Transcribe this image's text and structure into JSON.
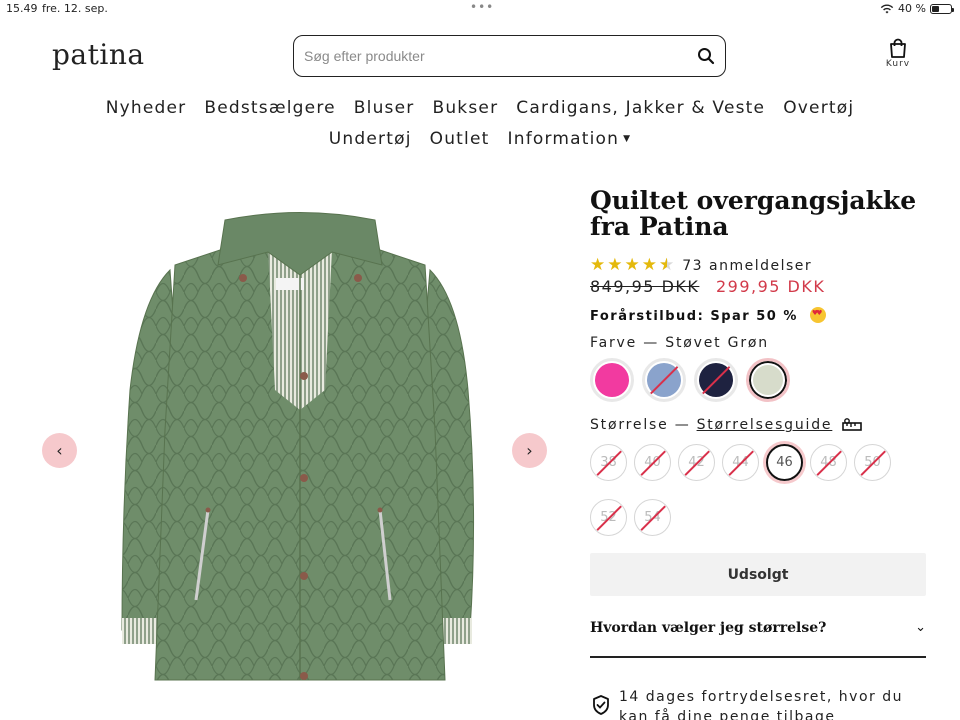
{
  "status_bar": {
    "time": "15.49",
    "date": "fre. 12. sep.",
    "dots": "•••",
    "battery_percent": "40 %"
  },
  "header": {
    "logo": "patina",
    "search_placeholder": "Søg efter produkter",
    "cart_label": "Kurv"
  },
  "nav": {
    "row1": [
      "Nyheder",
      "Bedstsælgere",
      "Bluser",
      "Bukser",
      "Cardigans, Jakker & Veste",
      "Overtøj"
    ],
    "row2": [
      "Undertøj",
      "Outlet",
      "Information"
    ]
  },
  "product": {
    "title": "Quiltet overgangsjakke fra Patina",
    "rating": 4.5,
    "reviews": "73 anmeldelser",
    "old_price": "849,95 DKK",
    "new_price": "299,95 DKK",
    "offer": "Forårstilbud: Spar 50 %",
    "color_label": "Farve — Støvet Grøn",
    "colors": [
      {
        "name": "pink",
        "hex": "#f23aa0",
        "available": true
      },
      {
        "name": "light-blue",
        "hex": "#8aa3cc",
        "available": false
      },
      {
        "name": "navy",
        "hex": "#1e2240",
        "available": false
      },
      {
        "name": "dusty-green",
        "hex": "#d7dccb",
        "available": true,
        "selected": true
      }
    ],
    "size_label": "Størrelse —",
    "size_guide": "Størrelsesguide",
    "sizes": [
      {
        "label": "38",
        "available": false
      },
      {
        "label": "40",
        "available": false
      },
      {
        "label": "42",
        "available": false
      },
      {
        "label": "44",
        "available": false
      },
      {
        "label": "46",
        "available": true,
        "selected": true
      },
      {
        "label": "48",
        "available": false
      },
      {
        "label": "50",
        "available": false
      },
      {
        "label": "52",
        "available": false
      },
      {
        "label": "54",
        "available": false
      }
    ],
    "soldout_label": "Udsolgt",
    "accordion_label": "Hvordan vælger jeg størrelse?",
    "return_text": "14 dages fortrydelsesret, hvor du kan få dine penge tilbage"
  },
  "colors": {
    "accent_pink": "#f6c9cc",
    "sale_red": "#d23a4a",
    "star_yellow": "#e4b90c",
    "jacket_green": "#6f8d6a"
  }
}
